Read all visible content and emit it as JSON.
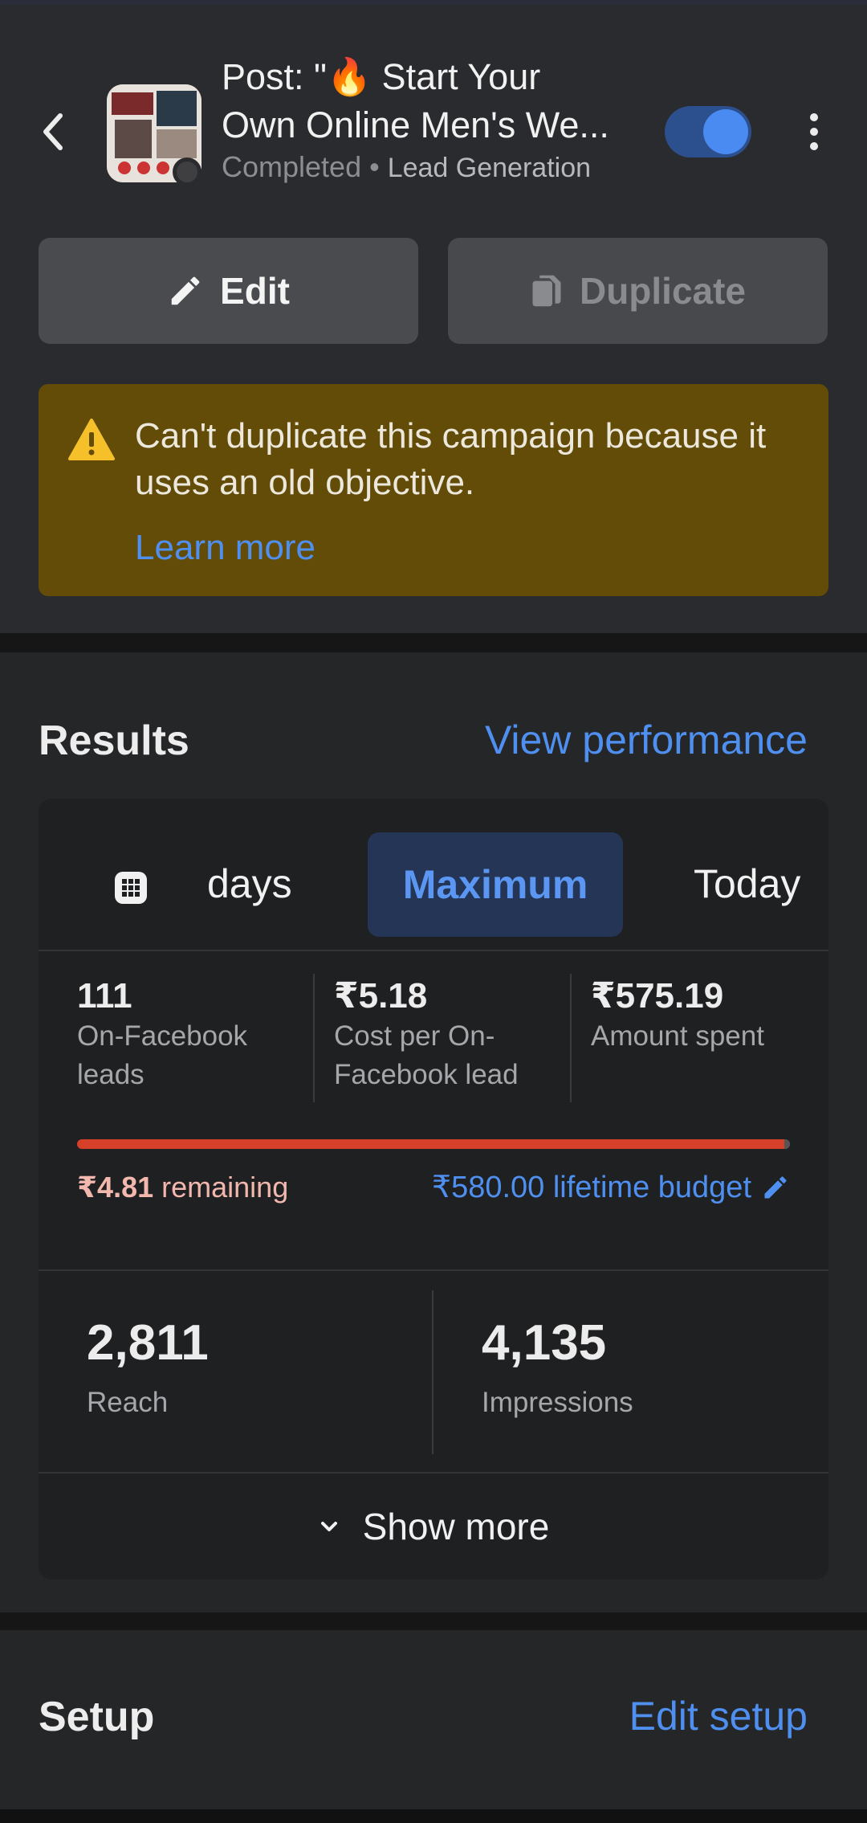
{
  "header": {
    "title_line1": "Post: \"🔥 Start Your",
    "title_line2": "Own Online Men's We...",
    "status": "Completed",
    "separator": " • ",
    "objective": "Lead Generation",
    "toggle_on": true
  },
  "actions": {
    "edit_label": "Edit",
    "duplicate_label": "Duplicate"
  },
  "warning": {
    "text": "Can't duplicate this campaign because it uses an old objective.",
    "link": "Learn more"
  },
  "results": {
    "title": "Results",
    "link": "View performance",
    "tabs": {
      "days": "days",
      "maximum": "Maximum",
      "today": "Today",
      "selected": "Maximum"
    },
    "metrics": [
      {
        "value": "111",
        "label": "On-Facebook leads"
      },
      {
        "value": "₹5.18",
        "label": "Cost per On-Facebook lead"
      },
      {
        "value": "₹575.19",
        "label": "Amount spent"
      }
    ],
    "budget": {
      "remaining_amount": "₹4.81",
      "remaining_label": "remaining",
      "lifetime_budget": "₹580.00 lifetime budget",
      "spent_fraction": 0.9917
    },
    "reach": {
      "value": "2,811",
      "label": "Reach"
    },
    "impressions": {
      "value": "4,135",
      "label": "Impressions"
    },
    "show_more": "Show more"
  },
  "setup": {
    "title": "Setup",
    "link": "Edit setup"
  },
  "colors": {
    "accent": "#4f8ff0",
    "warning_bg": "#634c08",
    "budget_bar": "#d6402b"
  }
}
